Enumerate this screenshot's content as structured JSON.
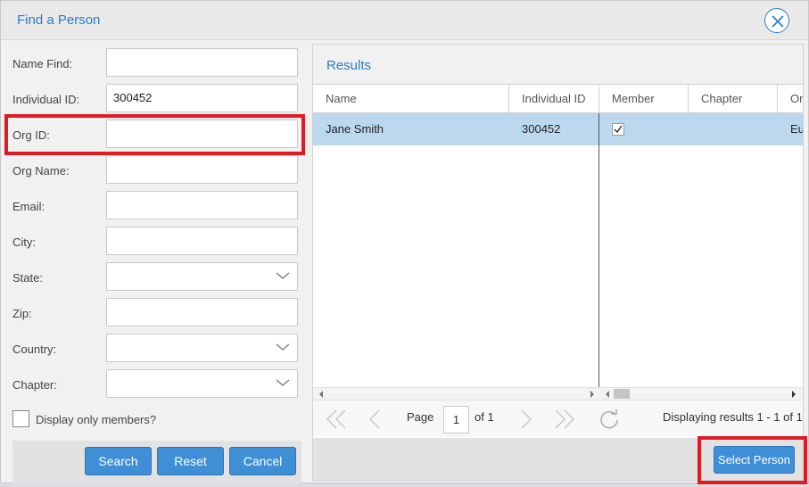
{
  "dialog": {
    "title": "Find a Person"
  },
  "form": {
    "fields": [
      {
        "label": "Name Find:",
        "value": ""
      },
      {
        "label": "Individual ID:",
        "value": "300452"
      },
      {
        "label": "Org ID:",
        "value": ""
      },
      {
        "label": "Org Name:",
        "value": ""
      },
      {
        "label": "Email:",
        "value": ""
      },
      {
        "label": "City:",
        "value": ""
      },
      {
        "label": "State:",
        "value": ""
      },
      {
        "label": "Zip:",
        "value": ""
      },
      {
        "label": "Country:",
        "value": ""
      },
      {
        "label": "Chapter:",
        "value": ""
      }
    ],
    "members_only_label": "Display only members?",
    "members_only_checked": false,
    "buttons": {
      "search": "Search",
      "reset": "Reset",
      "cancel": "Cancel"
    }
  },
  "results": {
    "title": "Results",
    "columns": [
      "Name",
      "Individual ID",
      "Member",
      "Chapter",
      "Or"
    ],
    "rows": [
      {
        "name": "Jane Smith",
        "individual_id": "300452",
        "member": true,
        "chapter": "",
        "org": "Eu"
      }
    ],
    "pager": {
      "page_label": "Page",
      "page": "1",
      "of_label": "of 1",
      "status": "Displaying results 1 - 1 of 1"
    },
    "select_label": "Select Person"
  },
  "colors": {
    "accent": "#2a7cc7",
    "button": "#3f8fd6",
    "highlight": "#e01b24",
    "selected_row": "#bcd8ef"
  }
}
